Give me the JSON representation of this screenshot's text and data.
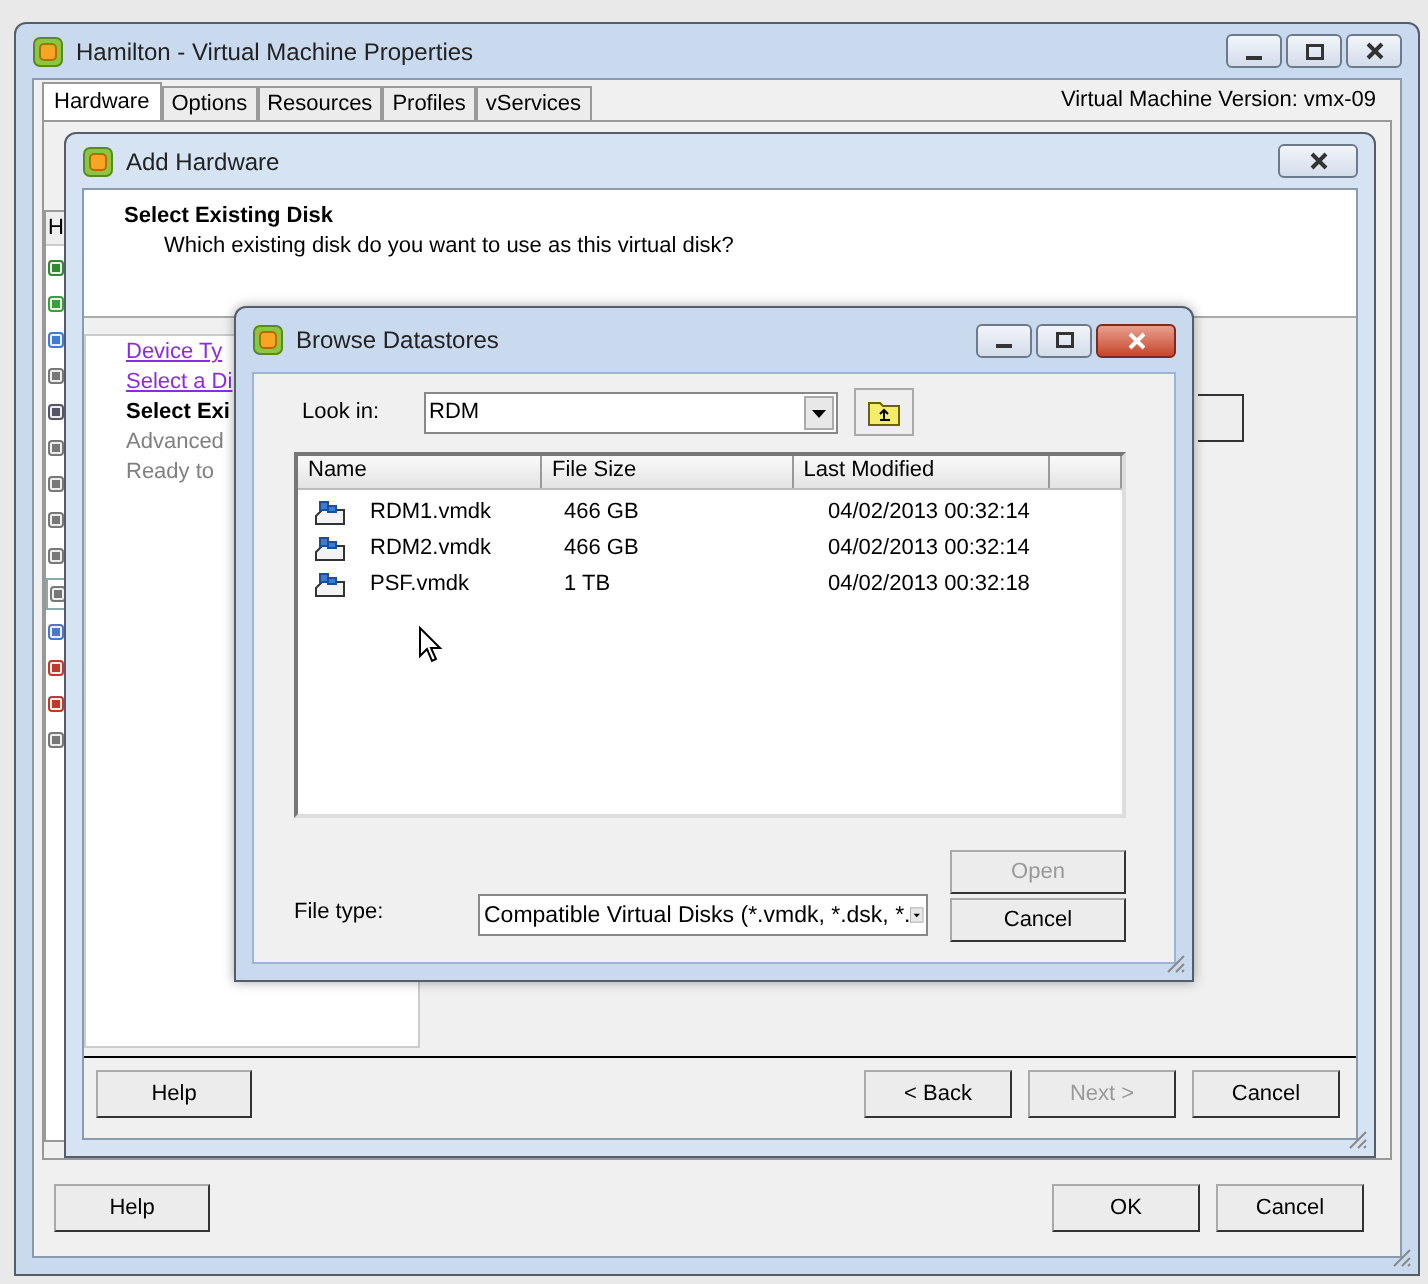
{
  "window": {
    "title": "Hamilton - Virtual Machine Properties",
    "tabs": [
      {
        "label": "Hardware",
        "selected": true
      },
      {
        "label": "Options",
        "selected": false
      },
      {
        "label": "Resources",
        "selected": false
      },
      {
        "label": "Profiles",
        "selected": false
      },
      {
        "label": "vServices",
        "selected": false
      }
    ],
    "version": "Virtual Machine Version: vmx-09",
    "list_header": "H",
    "buttons": [
      {
        "label": "Help"
      },
      {
        "label": "OK"
      },
      {
        "label": "Cancel"
      }
    ]
  },
  "wizard": {
    "title": "Add Hardware",
    "heading": "Select Existing Disk",
    "subheading": "Which existing disk do you want to use as this virtual disk?",
    "steps": [
      {
        "label": "Device Ty",
        "visited": true,
        "current": false
      },
      {
        "label": "Select a Di",
        "visited": true,
        "current": false
      },
      {
        "label": "Select Exi",
        "visited": false,
        "current": true
      },
      {
        "label": "Advanced",
        "visited": false,
        "current": false
      },
      {
        "label": "Ready to",
        "visited": false,
        "current": false
      }
    ],
    "buttons": [
      {
        "label": "Help",
        "disabled": false
      },
      {
        "label": "< Back",
        "disabled": false
      },
      {
        "label": "Next >",
        "disabled": true
      },
      {
        "label": "Cancel",
        "disabled": false
      }
    ]
  },
  "dialog": {
    "title": "Browse Datastores",
    "look_in_label": "Look in:",
    "look_in_value": "RDM",
    "columns": [
      "Name",
      "File Size",
      "Last Modified"
    ],
    "rows": [
      {
        "name": "RDM1.vmdk",
        "size": "466 GB",
        "modified": "04/02/2013 00:32:14"
      },
      {
        "name": "RDM2.vmdk",
        "size": "466 GB",
        "modified": "04/02/2013 00:32:14"
      },
      {
        "name": "PSF.vmdk",
        "size": "1 TB",
        "modified": "04/02/2013 00:32:18"
      }
    ],
    "file_type_label": "File type:",
    "file_type_value": "Compatible Virtual Disks (*.vmdk, *.dsk, *.",
    "buttons": [
      {
        "label": "Open",
        "disabled": true
      },
      {
        "label": "Cancel",
        "disabled": false
      }
    ]
  }
}
